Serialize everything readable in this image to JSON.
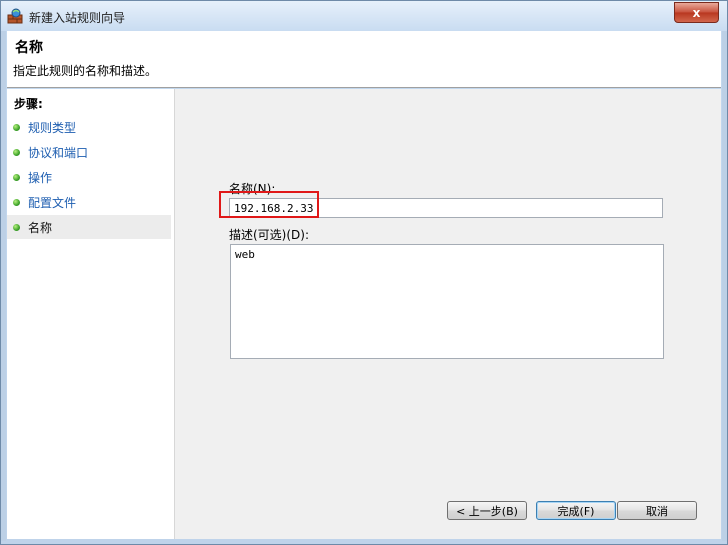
{
  "window": {
    "title": "新建入站规则向导",
    "close_label": "x"
  },
  "header": {
    "title": "名称",
    "description": "指定此规则的名称和描述。"
  },
  "steps": {
    "title": "步骤:",
    "items": [
      {
        "label": "规则类型"
      },
      {
        "label": "协议和端口"
      },
      {
        "label": "操作"
      },
      {
        "label": "配置文件"
      },
      {
        "label": "名称",
        "active": true
      }
    ]
  },
  "form": {
    "name_label": "名称(N):",
    "name_value": "192.168.2.33",
    "desc_label": "描述(可选)(D):",
    "desc_value": "web"
  },
  "buttons": {
    "back": "< 上一步(B)",
    "finish": "完成(F)",
    "cancel": "取消"
  }
}
